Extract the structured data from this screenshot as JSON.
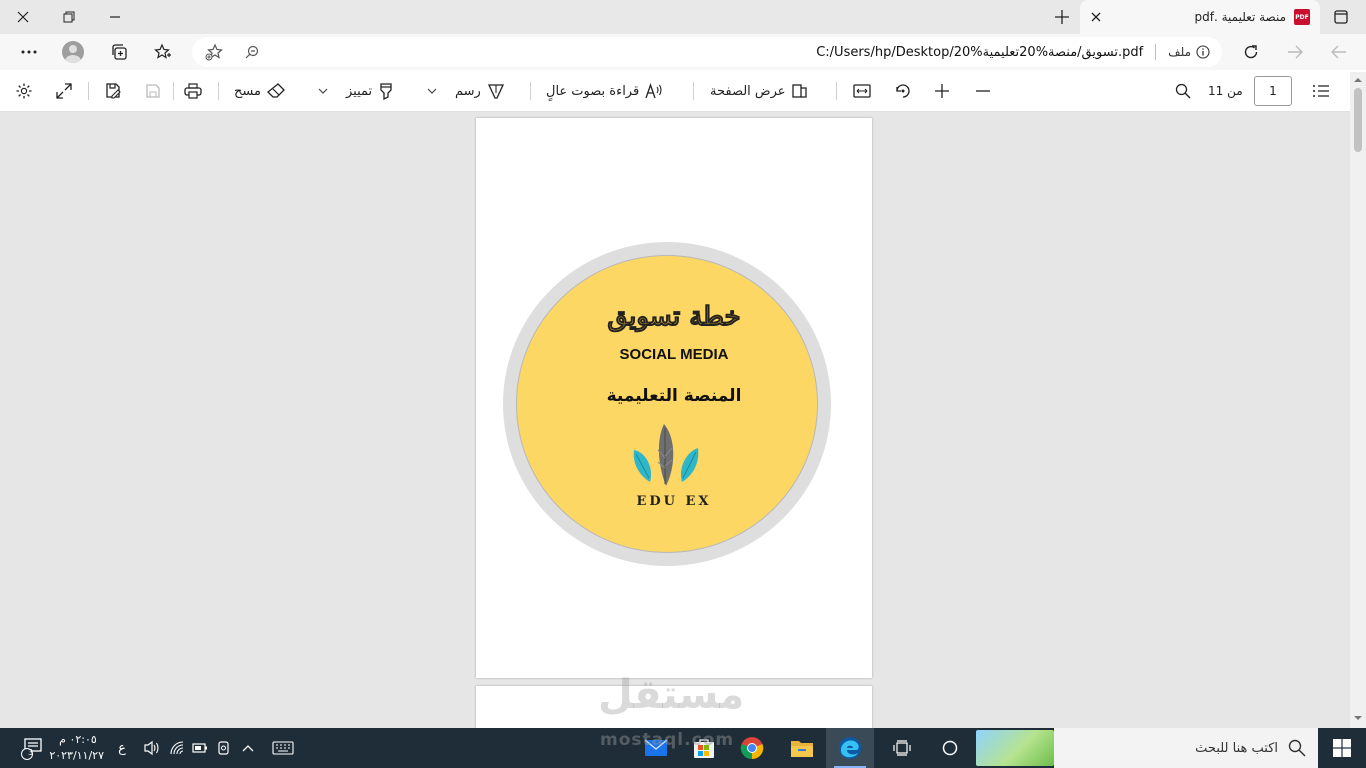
{
  "tab": {
    "title": "منصة تعليمية .pdf",
    "favicon_text": "PDF"
  },
  "address": {
    "file_label": "ملف",
    "url": "C:/Users/hp/Desktop/20%تسويق/منصة%20تعليمية.pdf"
  },
  "pdf_toolbar": {
    "page_current": "1",
    "page_of": "من 11",
    "page_view_label": "عرض الصفحة",
    "read_aloud_label": "قراءة بصوت عالٍ",
    "draw_label": "رسم",
    "highlight_label": "تمييز",
    "erase_label": "مسح"
  },
  "document": {
    "title_ar": "خطة تسويق",
    "subtitle": "SOCIAL MEDIA",
    "platform_ar": "المنصة التعليمية",
    "brand": "EDU EX"
  },
  "watermark": {
    "text_ar": "مستقل",
    "text_en": "mostaql.com"
  },
  "taskbar": {
    "search_placeholder": "اكتب هنا للبحث",
    "time": "٠٢:٠٥ م",
    "date": "٢٠٢٣/١١/٢٧",
    "lang": "ع",
    "notif_count": "3"
  },
  "colors": {
    "disc": "#fdd764",
    "ring": "#dedede",
    "taskbar": "#1f2d38",
    "leaf": "#2fb7c9"
  }
}
